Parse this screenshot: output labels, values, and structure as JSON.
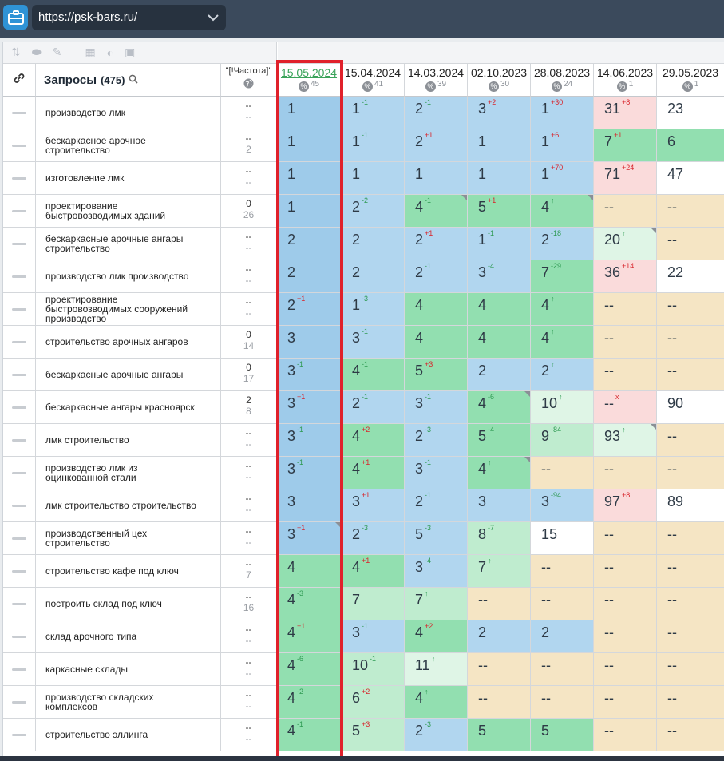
{
  "browser": {
    "url": "https://psk-bars.ru/"
  },
  "table": {
    "queries_label": "Запросы",
    "queries_count": "(475)",
    "freq_label": "\"[!Частота]\"",
    "columns": [
      {
        "date": "15.05.2024",
        "count": "45",
        "active": true
      },
      {
        "date": "15.04.2024",
        "count": "41"
      },
      {
        "date": "14.03.2024",
        "count": "39"
      },
      {
        "date": "02.10.2023",
        "count": "30"
      },
      {
        "date": "28.08.2023",
        "count": "24"
      },
      {
        "date": "14.06.2023",
        "count": "1"
      },
      {
        "date": "29.05.2023",
        "count": "1"
      }
    ],
    "rows": [
      {
        "q": "производство лмк",
        "f1": "--",
        "f2": "--",
        "cells": [
          [
            "1",
            "",
            "bd"
          ],
          [
            "1",
            "-1",
            "b"
          ],
          [
            "2",
            "-1",
            "b"
          ],
          [
            "3",
            "+2",
            "b"
          ],
          [
            "1",
            "+30",
            "b"
          ],
          [
            "31",
            "+8",
            "p"
          ],
          [
            "23",
            "",
            "w"
          ]
        ]
      },
      {
        "q": "бескаркасное арочное строительство",
        "f1": "--",
        "f2": "2",
        "cells": [
          [
            "1",
            "",
            "bd"
          ],
          [
            "1",
            "-1",
            "b"
          ],
          [
            "2",
            "+1",
            "b"
          ],
          [
            "1",
            "",
            "b"
          ],
          [
            "1",
            "+6",
            "b"
          ],
          [
            "7",
            "+1",
            "g"
          ],
          [
            "6",
            "",
            "g"
          ]
        ]
      },
      {
        "q": "изготовление лмк",
        "f1": "--",
        "f2": "--",
        "cells": [
          [
            "1",
            "",
            "bd"
          ],
          [
            "1",
            "",
            "b"
          ],
          [
            "1",
            "",
            "b"
          ],
          [
            "1",
            "",
            "b"
          ],
          [
            "1",
            "+70",
            "b"
          ],
          [
            "71",
            "+24",
            "p"
          ],
          [
            "47",
            "",
            "w"
          ]
        ]
      },
      {
        "q": "проектирование быстровозводимых зданий",
        "f1": "0",
        "f2": "26",
        "cells": [
          [
            "1",
            "",
            "bd"
          ],
          [
            "2",
            "-2",
            "b"
          ],
          [
            "4",
            "-1",
            "g"
          ],
          [
            "5",
            "+1",
            "g"
          ],
          [
            "4",
            "↑",
            "g"
          ],
          [
            "--",
            "",
            "y"
          ],
          [
            "--",
            "",
            "y"
          ]
        ]
      },
      {
        "q": "бескаркасные арочные ангары строительство",
        "f1": "--",
        "f2": "--",
        "cells": [
          [
            "2",
            "",
            "bd"
          ],
          [
            "2",
            "",
            "b"
          ],
          [
            "2",
            "+1",
            "b"
          ],
          [
            "1",
            "-1",
            "b"
          ],
          [
            "2",
            "-18",
            "b"
          ],
          [
            "20",
            "↑",
            "ge"
          ],
          [
            "--",
            "",
            "y"
          ]
        ]
      },
      {
        "q": "производство лмк производство",
        "f1": "--",
        "f2": "--",
        "cells": [
          [
            "2",
            "",
            "bd"
          ],
          [
            "2",
            "",
            "b"
          ],
          [
            "2",
            "-1",
            "b"
          ],
          [
            "3",
            "-4",
            "b"
          ],
          [
            "7",
            "-29",
            "g"
          ],
          [
            "36",
            "+14",
            "p"
          ],
          [
            "22",
            "",
            "w"
          ]
        ]
      },
      {
        "q": "проектирование быстровозводимых сооружений производство",
        "f1": "--",
        "f2": "--",
        "cells": [
          [
            "2",
            "+1",
            "bd"
          ],
          [
            "1",
            "-3",
            "b"
          ],
          [
            "4",
            "",
            "g"
          ],
          [
            "4",
            "",
            "g"
          ],
          [
            "4",
            "↑",
            "g"
          ],
          [
            "--",
            "",
            "y"
          ],
          [
            "--",
            "",
            "y"
          ]
        ]
      },
      {
        "q": "строительство арочных ангаров",
        "f1": "0",
        "f2": "14",
        "cells": [
          [
            "3",
            "",
            "bd"
          ],
          [
            "3",
            "-1",
            "b"
          ],
          [
            "4",
            "",
            "g"
          ],
          [
            "4",
            "",
            "g"
          ],
          [
            "4",
            "↑",
            "g"
          ],
          [
            "--",
            "",
            "y"
          ],
          [
            "--",
            "",
            "y"
          ]
        ]
      },
      {
        "q": "бескаркасные арочные ангары",
        "f1": "0",
        "f2": "17",
        "cells": [
          [
            "3",
            "-1",
            "bd"
          ],
          [
            "4",
            "-1",
            "g"
          ],
          [
            "5",
            "+3",
            "g"
          ],
          [
            "2",
            "",
            "b"
          ],
          [
            "2",
            "↑",
            "b"
          ],
          [
            "--",
            "",
            "y"
          ],
          [
            "--",
            "",
            "y"
          ]
        ]
      },
      {
        "q": "бескаркасные ангары красноярск",
        "f1": "2",
        "f2": "8",
        "cells": [
          [
            "3",
            "+1",
            "bd"
          ],
          [
            "2",
            "-1",
            "b"
          ],
          [
            "3",
            "-1",
            "b"
          ],
          [
            "4",
            "-6",
            "g"
          ],
          [
            "10",
            "↑",
            "ge"
          ],
          [
            "--",
            "x",
            "p"
          ],
          [
            "90",
            "",
            "w"
          ]
        ]
      },
      {
        "q": "лмк строительство",
        "f1": "--",
        "f2": "--",
        "cells": [
          [
            "3",
            "-1",
            "bd"
          ],
          [
            "4",
            "+2",
            "g"
          ],
          [
            "2",
            "-3",
            "b"
          ],
          [
            "5",
            "-4",
            "g"
          ],
          [
            "9",
            "-84",
            "gl"
          ],
          [
            "93",
            "↑",
            "ge"
          ],
          [
            "--",
            "",
            "y"
          ]
        ]
      },
      {
        "q": "производство лмк из оцинкованной стали",
        "f1": "--",
        "f2": "--",
        "cells": [
          [
            "3",
            "-1",
            "bd"
          ],
          [
            "4",
            "+1",
            "g"
          ],
          [
            "3",
            "-1",
            "b"
          ],
          [
            "4",
            "↑",
            "g"
          ],
          [
            "--",
            "",
            "y"
          ],
          [
            "--",
            "",
            "y"
          ],
          [
            "--",
            "",
            "y"
          ]
        ]
      },
      {
        "q": "лмк строительство строительство",
        "f1": "--",
        "f2": "--",
        "cells": [
          [
            "3",
            "",
            "bd"
          ],
          [
            "3",
            "+1",
            "b"
          ],
          [
            "2",
            "-1",
            "b"
          ],
          [
            "3",
            "",
            "b"
          ],
          [
            "3",
            "-94",
            "b"
          ],
          [
            "97",
            "+8",
            "p"
          ],
          [
            "89",
            "",
            "w"
          ]
        ]
      },
      {
        "q": "производственный цех строительство",
        "f1": "--",
        "f2": "--",
        "cells": [
          [
            "3",
            "+1",
            "bd"
          ],
          [
            "2",
            "-3",
            "b"
          ],
          [
            "5",
            "-3",
            "b"
          ],
          [
            "8",
            "-7",
            "gl"
          ],
          [
            "15",
            "",
            "w"
          ],
          [
            "--",
            "",
            "y"
          ],
          [
            "--",
            "",
            "y"
          ]
        ]
      },
      {
        "q": "строительство кафе под ключ",
        "f1": "--",
        "f2": "7",
        "cells": [
          [
            "4",
            "",
            "g"
          ],
          [
            "4",
            "+1",
            "g"
          ],
          [
            "3",
            "-4",
            "b"
          ],
          [
            "7",
            "↑",
            "gl"
          ],
          [
            "--",
            "",
            "y"
          ],
          [
            "--",
            "",
            "y"
          ],
          [
            "--",
            "",
            "y"
          ]
        ]
      },
      {
        "q": "построить склад под ключ",
        "f1": "--",
        "f2": "16",
        "cells": [
          [
            "4",
            "-3",
            "g"
          ],
          [
            "7",
            "",
            "gl"
          ],
          [
            "7",
            "↑",
            "gl"
          ],
          [
            "--",
            "",
            "y"
          ],
          [
            "--",
            "",
            "y"
          ],
          [
            "--",
            "",
            "y"
          ],
          [
            "--",
            "",
            "y"
          ]
        ]
      },
      {
        "q": "склад арочного типа",
        "f1": "--",
        "f2": "--",
        "cells": [
          [
            "4",
            "+1",
            "g"
          ],
          [
            "3",
            "-1",
            "b"
          ],
          [
            "4",
            "+2",
            "g"
          ],
          [
            "2",
            "",
            "b"
          ],
          [
            "2",
            "",
            "b"
          ],
          [
            "--",
            "",
            "y"
          ],
          [
            "--",
            "",
            "y"
          ]
        ]
      },
      {
        "q": "каркасные склады",
        "f1": "--",
        "f2": "--",
        "cells": [
          [
            "4",
            "-6",
            "g"
          ],
          [
            "10",
            "-1",
            "gl"
          ],
          [
            "11",
            "↑",
            "ge"
          ],
          [
            "--",
            "",
            "y"
          ],
          [
            "--",
            "",
            "y"
          ],
          [
            "--",
            "",
            "y"
          ],
          [
            "--",
            "",
            "y"
          ]
        ]
      },
      {
        "q": "производство складских комплексов",
        "f1": "--",
        "f2": "--",
        "cells": [
          [
            "4",
            "-2",
            "g"
          ],
          [
            "6",
            "+2",
            "gl"
          ],
          [
            "4",
            "↑",
            "g"
          ],
          [
            "--",
            "",
            "y"
          ],
          [
            "--",
            "",
            "y"
          ],
          [
            "--",
            "",
            "y"
          ],
          [
            "--",
            "",
            "y"
          ]
        ]
      },
      {
        "q": "строительство эллинга",
        "f1": "--",
        "f2": "--",
        "cells": [
          [
            "4",
            "-1",
            "g"
          ],
          [
            "5",
            "+3",
            "gl"
          ],
          [
            "2",
            "-3",
            "b"
          ],
          [
            "5",
            "",
            "g"
          ],
          [
            "5",
            "",
            "g"
          ],
          [
            "--",
            "",
            "y"
          ],
          [
            "--",
            "",
            "y"
          ]
        ]
      }
    ]
  }
}
